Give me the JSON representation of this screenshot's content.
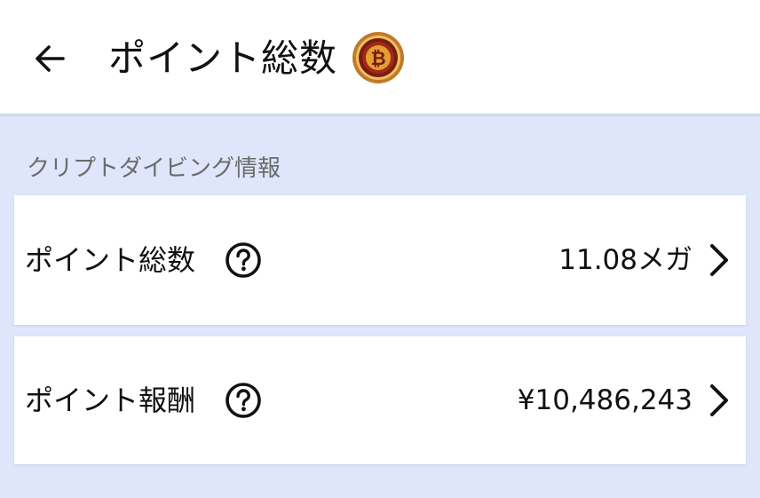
{
  "header": {
    "back_icon": "arrow-left-icon",
    "title": "ポイント総数",
    "coin_icon": "bitcoin-coin-icon",
    "coin_colors": {
      "outer": "#c07a2c",
      "ring": "#7a1c12",
      "inner": "#e3a030"
    }
  },
  "section": {
    "title": "クリプトダイビング情報"
  },
  "rows": [
    {
      "label": "ポイント総数",
      "help_icon": "question-circle-icon",
      "value": "11.08メガ",
      "chevron_icon": "chevron-right-icon"
    },
    {
      "label": "ポイント報酬",
      "help_icon": "question-circle-icon",
      "value": "¥10,486,243",
      "chevron_icon": "chevron-right-icon"
    }
  ],
  "colors": {
    "background": "#dfe6fb",
    "appbar": "#ffffff",
    "card": "#ffffff",
    "section_title": "#6b6b6b",
    "text": "#111111"
  }
}
